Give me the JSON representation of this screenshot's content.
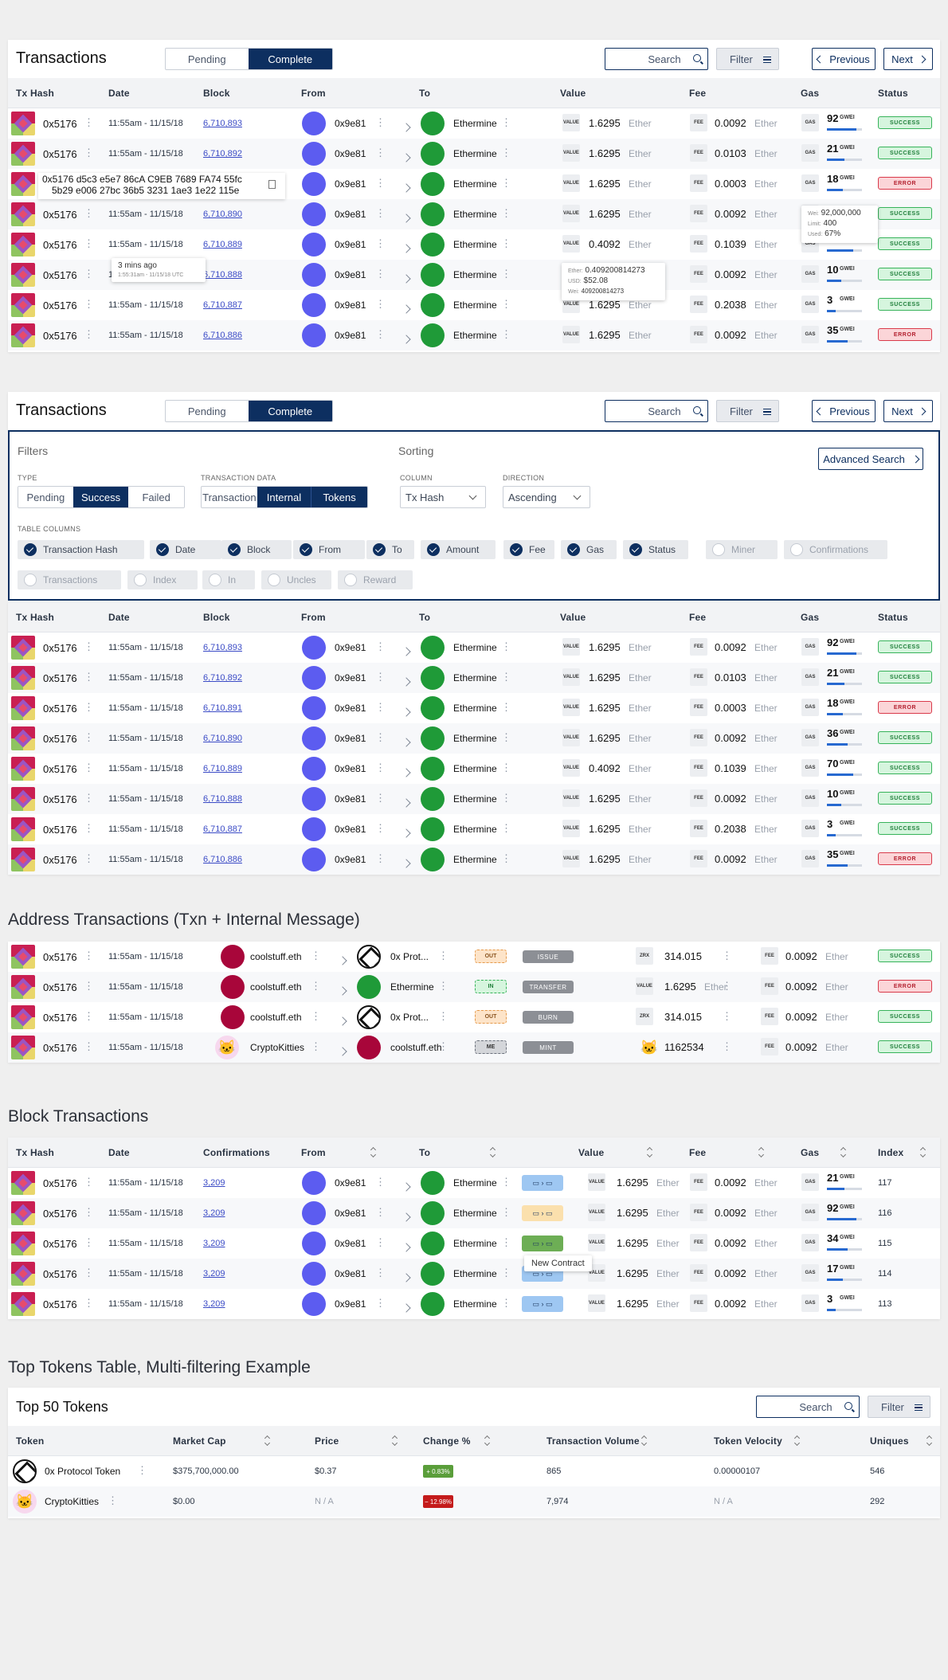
{
  "t1": {
    "title": "Transactions",
    "pending": "Pending",
    "complete": "Complete",
    "search": "Search",
    "filter": "Filter",
    "previous": "Previous",
    "next": "Next"
  },
  "cols": {
    "hash": "Tx Hash",
    "date": "Date",
    "block": "Block",
    "from": "From",
    "to": "To",
    "value": "Value",
    "fee": "Fee",
    "gas": "Gas",
    "status": "Status",
    "confirmations": "Confirmations",
    "index": "Index"
  },
  "rows": [
    {
      "hash": "0x5176",
      "date": "11:55am - 11/15/18",
      "block": "6,710,893",
      "from": "0x9e81",
      "to": "Ethermine",
      "value": "1.6295",
      "fee": "0.0092",
      "gas": "92",
      "gas_level": 0.85,
      "status": "SUCCESS",
      "ok": true
    },
    {
      "hash": "0x5176",
      "date": "11:55am - 11/15/18",
      "block": "6,710,892",
      "from": "0x9e81",
      "to": "Ethermine",
      "value": "1.6295",
      "fee": "0.0103",
      "gas": "21",
      "gas_level": 0.5,
      "status": "SUCCESS",
      "ok": true
    },
    {
      "hash": "0x5176",
      "date": "11:55am - 11/15/18",
      "block": "6,710,891",
      "from": "0x9e81",
      "to": "Ethermine",
      "value": "1.6295",
      "fee": "0.0003",
      "gas": "18",
      "gas_level": 0.45,
      "status": "ERROR",
      "ok": false
    },
    {
      "hash": "0x5176",
      "date": "11:55am - 11/15/18",
      "block": "6,710,890",
      "from": "0x9e81",
      "to": "Ethermine",
      "value": "1.6295",
      "fee": "0.0092",
      "gas": "36",
      "gas_level": 0.6,
      "status": "SUCCESS",
      "ok": true
    },
    {
      "hash": "0x5176",
      "date": "11:55am - 11/15/18",
      "block": "6,710,889",
      "from": "0x9e81",
      "to": "Ethermine",
      "value": "0.4092",
      "fee": "0.1039",
      "gas": "70",
      "gas_level": 0.75,
      "status": "SUCCESS",
      "ok": true
    },
    {
      "hash": "0x5176",
      "date": "11:55am - 11/15/18",
      "block": "6,710,888",
      "from": "0x9e81",
      "to": "Ethermine",
      "value": "1.6295",
      "fee": "0.0092",
      "gas": "10",
      "gas_level": 0.4,
      "status": "SUCCESS",
      "ok": true
    },
    {
      "hash": "0x5176",
      "date": "11:55am - 11/15/18",
      "block": "6,710,887",
      "from": "0x9e81",
      "to": "Ethermine",
      "value": "1.6295",
      "fee": "0.2038",
      "gas": "3",
      "gas_level": 0.25,
      "status": "SUCCESS",
      "ok": true
    },
    {
      "hash": "0x5176",
      "date": "11:55am - 11/15/18",
      "block": "6,710,886",
      "from": "0x9e81",
      "to": "Ethermine",
      "value": "1.6295",
      "fee": "0.0092",
      "gas": "35",
      "gas_level": 0.6,
      "status": "ERROR",
      "ok": false
    }
  ],
  "labels": {
    "value": "VALUE",
    "fee": "FEE",
    "gas": "GAS",
    "gwei": "GWEI",
    "ether": "Ether",
    "zrx": "ZRX"
  },
  "expanded_hash": {
    "line1": "0x5176 d5c3 e5e7 86cA C9EB 7689 FA74 55fc",
    "line2": "5b29 e006 27bc 36b5 3231 1ae3 1e22 115e"
  },
  "tip_date": {
    "main": "3 mins ago",
    "sub": "1:55:31am - 11/15/18 UTC"
  },
  "tip_value": {
    "ether_l": "Ether:",
    "ether": "0.409200814273",
    "usd_l": "USD:",
    "usd": "$52.08",
    "wei_l": "Wei:",
    "wei": "409200814273"
  },
  "tip_gas": {
    "wei_l": "Wei:",
    "wei": "92,000,000",
    "limit_l": "Limit:",
    "limit": "400",
    "used_l": "Used:",
    "used": "67%"
  },
  "filters": {
    "title": "Filters",
    "sorting": "Sorting",
    "type": "TYPE",
    "type_opts": [
      "Pending",
      "Success",
      "Failed"
    ],
    "txdata": "TRANSACTION DATA",
    "txdata_opts": [
      "Transaction",
      "Internal",
      "Tokens"
    ],
    "column": "COLUMN",
    "column_val": "Tx Hash",
    "direction": "DIRECTION",
    "direction_val": "Ascending",
    "adv": "Advanced Search",
    "tcols": "TABLE COLUMNS",
    "chips_on": [
      "Transaction Hash",
      "Date",
      "Block",
      "From",
      "To",
      "Amount",
      "Fee",
      "Gas",
      "Status"
    ],
    "chips_off": [
      "Miner",
      "Confirmations",
      "Transactions",
      "Index",
      "In",
      "Uncles",
      "Reward"
    ]
  },
  "addr": {
    "title": "Address Transactions (Txn + Internal Message)",
    "rows": [
      {
        "hash": "0x5176",
        "date": "11:55am - 11/15/18",
        "from": "coolstuff.eth",
        "to": "0x Prot...",
        "dir": "OUT",
        "action": "ISSUE",
        "vlab": "ZRX",
        "value": "314.015",
        "unit": "",
        "fee": "0.0092",
        "status": "SUCCESS",
        "ok": true
      },
      {
        "hash": "0x5176",
        "date": "11:55am - 11/15/18",
        "from": "coolstuff.eth",
        "to": "Ethermine",
        "dir": "IN",
        "action": "TRANSFER",
        "vlab": "VALUE",
        "value": "1.6295",
        "unit": "Ether",
        "fee": "0.0092",
        "status": "ERROR",
        "ok": false
      },
      {
        "hash": "0x5176",
        "date": "11:55am - 11/15/18",
        "from": "coolstuff.eth",
        "to": "0x Prot...",
        "dir": "OUT",
        "action": "BURN",
        "vlab": "ZRX",
        "value": "314.015",
        "unit": "",
        "fee": "0.0092",
        "status": "SUCCESS",
        "ok": true
      },
      {
        "hash": "0x5176",
        "date": "11:55am - 11/15/18",
        "from": "CryptoKitties",
        "to": "coolstuff.eth",
        "dir": "ME",
        "action": "MINT",
        "vlab": "",
        "value": "1162534",
        "unit": "",
        "fee": "0.0092",
        "status": "SUCCESS",
        "ok": true
      }
    ]
  },
  "block": {
    "title": "Block Transactions",
    "rows": [
      {
        "hash": "0x5176",
        "date": "11:55am - 11/15/18",
        "conf": "3,209",
        "from": "0x9e81",
        "to": "Ethermine",
        "value": "1.6295",
        "fee": "0.0092",
        "gas": "21",
        "gas_level": 0.5,
        "index": "117"
      },
      {
        "hash": "0x5176",
        "date": "11:55am - 11/15/18",
        "conf": "3,209",
        "from": "0x9e81",
        "to": "Ethermine",
        "value": "1.6295",
        "fee": "0.0092",
        "gas": "92",
        "gas_level": 0.85,
        "index": "116"
      },
      {
        "hash": "0x5176",
        "date": "11:55am - 11/15/18",
        "conf": "3,209",
        "from": "0x9e81",
        "to": "Ethermine",
        "value": "1.6295",
        "fee": "0.0092",
        "gas": "34",
        "gas_level": 0.6,
        "index": "115"
      },
      {
        "hash": "0x5176",
        "date": "11:55am - 11/15/18",
        "conf": "3,209",
        "from": "0x9e81",
        "to": "Ethermine",
        "value": "1.6295",
        "fee": "0.0092",
        "gas": "17",
        "gas_level": 0.45,
        "index": "114"
      },
      {
        "hash": "0x5176",
        "date": "11:55am - 11/15/18",
        "conf": "3,209",
        "from": "0x9e81",
        "to": "Ethermine",
        "value": "1.6295",
        "fee": "0.0092",
        "gas": "3",
        "gas_level": 0.25,
        "index": "113"
      }
    ],
    "new_contract": "New Contract"
  },
  "tokens": {
    "section": "Top Tokens Table, Multi-filtering Example",
    "title": "Top 50 Tokens",
    "search": "Search",
    "filter": "Filter",
    "cols": [
      "Token",
      "Market Cap",
      "Price",
      "Change %",
      "Transaction Volume",
      "Token Velocity",
      "Uniques"
    ],
    "rows": [
      {
        "name": "0x Protocol Token",
        "cap": "$375,700,000.00",
        "price": "$0.37",
        "change": "+ 0.83%",
        "up": true,
        "volume": "865",
        "velocity": "0.00000107",
        "uniques": "546"
      },
      {
        "name": "CryptoKitties",
        "cap": "$0.00",
        "price": "N / A",
        "change": "− 12.98%",
        "up": false,
        "volume": "7,974",
        "velocity": "N / A",
        "uniques": "292"
      }
    ]
  },
  "colors": {
    "navy": "#0d2f60",
    "success": "#37b35a",
    "error": "#d93a4b",
    "link": "#3b4bc6",
    "purple": "#5c5cf0",
    "green": "#1f9a38"
  }
}
